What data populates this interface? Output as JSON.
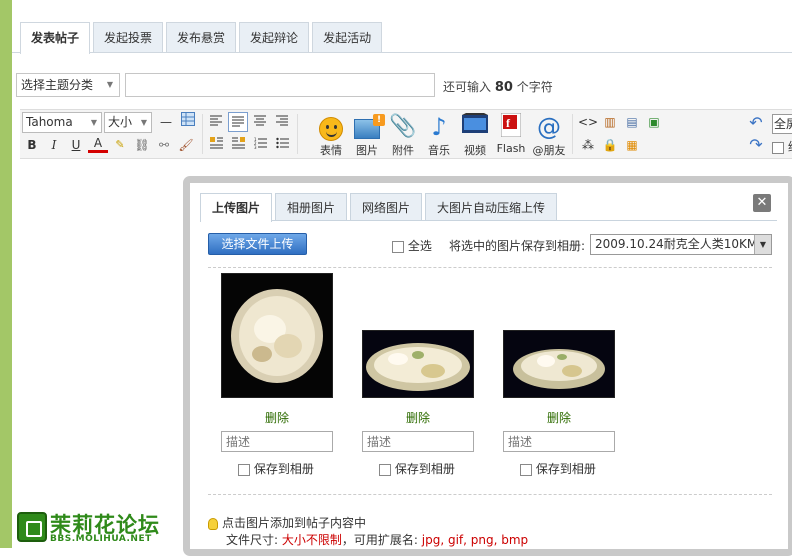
{
  "post_tabs": [
    {
      "label": "发表帖子",
      "active": true
    },
    {
      "label": "发起投票",
      "active": false
    },
    {
      "label": "发布悬赏",
      "active": false
    },
    {
      "label": "发起辩论",
      "active": false
    },
    {
      "label": "发起活动",
      "active": false
    }
  ],
  "subject": {
    "category_placeholder": "选择主题分类",
    "title_value": "",
    "char_hint_prefix": "还可输入",
    "char_hint_count": "80",
    "char_hint_suffix": "个字符"
  },
  "toolbar": {
    "font_name": "Tahoma",
    "font_size": "大小",
    "buttons": [
      {
        "label": "表情",
        "icon": "smiley-icon"
      },
      {
        "label": "图片",
        "icon": "image-icon"
      },
      {
        "label": "附件",
        "icon": "paperclip-icon"
      },
      {
        "label": "音乐",
        "icon": "music-note-icon"
      },
      {
        "label": "视频",
        "icon": "video-icon"
      },
      {
        "label": "Flash",
        "icon": "flash-icon"
      },
      {
        "label": "@朋友",
        "icon": "at-icon"
      }
    ],
    "fullscreen_label": "全屏",
    "plain_text_label": "纯文"
  },
  "upload_dialog": {
    "tabs": [
      {
        "label": "上传图片",
        "active": true
      },
      {
        "label": "相册图片",
        "active": false
      },
      {
        "label": "网络图片",
        "active": false
      },
      {
        "label": "大图片自动压缩上传",
        "active": false
      }
    ],
    "choose_button": "选择文件上传",
    "select_all_label": "全选",
    "save_to_album_label": "将选中的图片保存到相册:",
    "album_selected": "2009.10.24耐克全人类10KM",
    "photos": [
      {
        "delete_label": "删除",
        "desc_placeholder": "描述",
        "save_label": "保存到相册"
      },
      {
        "delete_label": "删除",
        "desc_placeholder": "描述",
        "save_label": "保存到相册"
      },
      {
        "delete_label": "删除",
        "desc_placeholder": "描述",
        "save_label": "保存到相册"
      }
    ],
    "tip": "点击图片添加到帖子内容中",
    "file_size_label": "文件尺寸:",
    "file_size_value": "大小不限制",
    "ext_label": "，可用扩展名:",
    "ext_value": "jpg, gif, png, bmp"
  },
  "watermark": {
    "name": "茉莉花论坛",
    "url": "BBS.MOLIHUA.NET"
  },
  "colors": {
    "left_bar": "#a3c767",
    "tab_bg": "#e9eff5",
    "accent_blue": "#2f6fc2",
    "delete_green": "#2d6b00",
    "warning_red": "#cc0000"
  }
}
